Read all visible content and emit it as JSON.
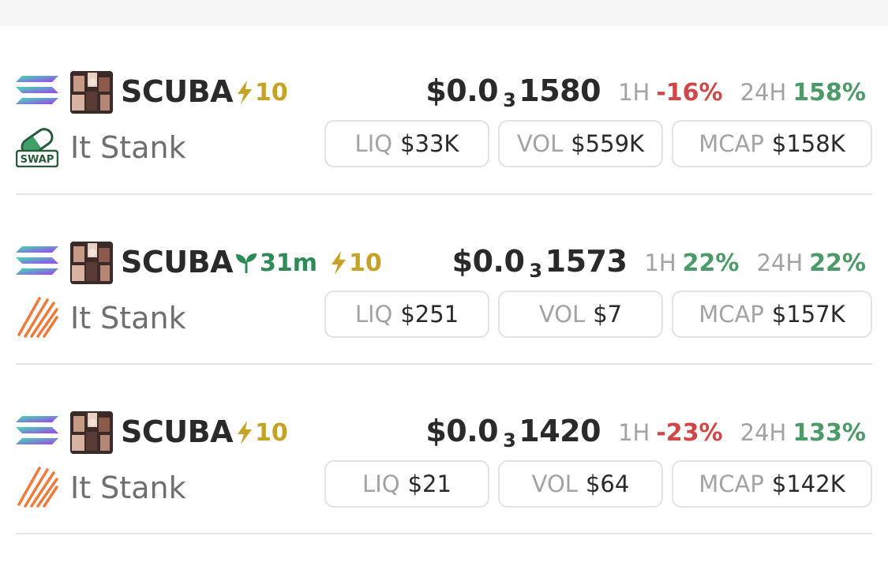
{
  "colors": {
    "negative": "#d04747",
    "positive": "#4c9a68",
    "boost": "#c6a227",
    "age": "#2e8a57"
  },
  "rows": [
    {
      "chain_icon": "solana-icon",
      "symbol": "SCUBA",
      "age": "",
      "boost": "10",
      "price_prefix": "$0.0",
      "price_zero_count": "3",
      "price_digits": "1580",
      "h1_label": "1H",
      "h1_change": "-16%",
      "h1_direction": "negative",
      "h24_label": "24H",
      "h24_change": "158%",
      "h24_direction": "positive",
      "dex_icon": "swap-pill-icon",
      "pair_name": "It Stank",
      "liq_label": "LIQ",
      "liq_value": "$33K",
      "vol_label": "VOL",
      "vol_value": "$559K",
      "mcap_label": "MCAP",
      "mcap_value": "$158K"
    },
    {
      "chain_icon": "solana-icon",
      "symbol": "SCUBA",
      "age": "31m",
      "boost": "10",
      "price_prefix": "$0.0",
      "price_zero_count": "3",
      "price_digits": "1573",
      "h1_label": "1H",
      "h1_change": "22%",
      "h1_direction": "positive",
      "h24_label": "24H",
      "h24_change": "22%",
      "h24_direction": "positive",
      "dex_icon": "orange-slashes-icon",
      "pair_name": "It Stank",
      "liq_label": "LIQ",
      "liq_value": "$251",
      "vol_label": "VOL",
      "vol_value": "$7",
      "mcap_label": "MCAP",
      "mcap_value": "$157K"
    },
    {
      "chain_icon": "solana-icon",
      "symbol": "SCUBA",
      "age": "",
      "boost": "10",
      "price_prefix": "$0.0",
      "price_zero_count": "3",
      "price_digits": "1420",
      "h1_label": "1H",
      "h1_change": "-23%",
      "h1_direction": "negative",
      "h24_label": "24H",
      "h24_change": "133%",
      "h24_direction": "positive",
      "dex_icon": "orange-slashes-icon",
      "pair_name": "It Stank",
      "liq_label": "LIQ",
      "liq_value": "$21",
      "vol_label": "VOL",
      "vol_value": "$64",
      "mcap_label": "MCAP",
      "mcap_value": "$142K"
    }
  ]
}
